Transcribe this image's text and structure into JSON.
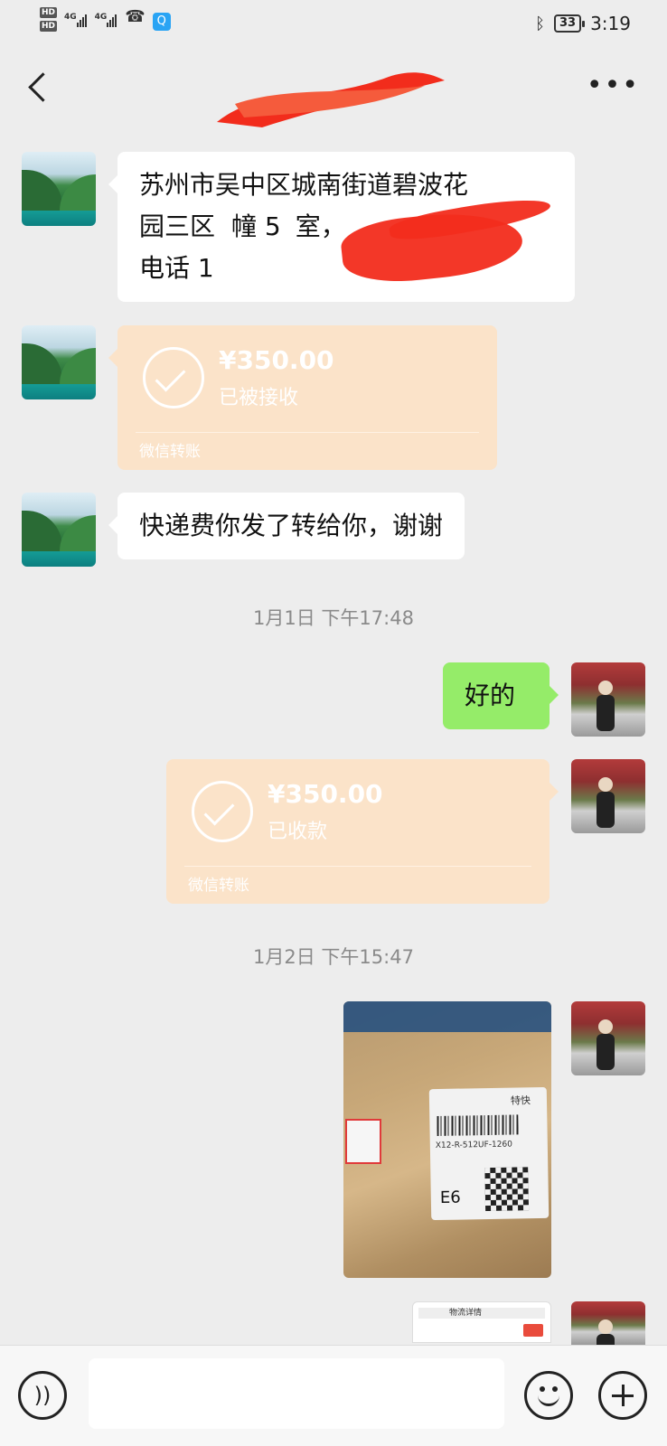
{
  "status_bar": {
    "sim1": "HD",
    "sim2": "HD",
    "network1": "4G",
    "network2": "4G",
    "battery": "33",
    "time": "3:19",
    "icons": [
      "bluetooth-icon",
      "missed-call-icon",
      "qq-icon"
    ]
  },
  "header": {
    "more": "•••"
  },
  "messages": [
    {
      "side": "left",
      "type": "text",
      "line1": "苏州市吴中区城南街道碧波花",
      "line2": "园三区",
      "line2_b": "幢 5",
      "line2_c": "室，",
      "line3": "电话 1"
    },
    {
      "side": "left",
      "type": "transfer",
      "amount": "¥350.00",
      "status": "已被接收",
      "brand": "微信转账"
    },
    {
      "side": "left",
      "type": "text",
      "text": "快递费你发了转给你，谢谢"
    },
    {
      "type": "timestamp",
      "text": "1月1日 下午17:48"
    },
    {
      "side": "right",
      "type": "text",
      "text": "好的"
    },
    {
      "side": "right",
      "type": "transfer",
      "amount": "¥350.00",
      "status": "已收款",
      "brand": "微信转账"
    },
    {
      "type": "timestamp",
      "text": "1月2日 下午15:47"
    },
    {
      "side": "right",
      "type": "image",
      "photo_label_code": "X12-R-512UF-1260",
      "photo_label_tag": "E6",
      "photo_label_top": "特快"
    },
    {
      "side": "right",
      "type": "image-partial",
      "caption": "物流详情"
    }
  ],
  "input": {
    "placeholder": ""
  }
}
